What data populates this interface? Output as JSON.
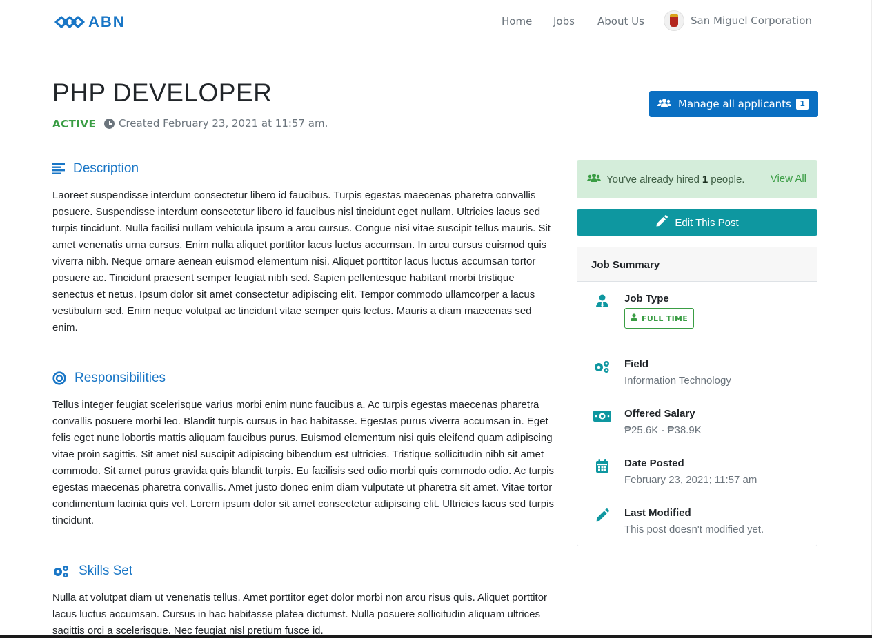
{
  "nav": {
    "brand": "ABN",
    "home": "Home",
    "jobs": "Jobs",
    "about": "About Us",
    "company": "San Miguel Corporation"
  },
  "job": {
    "title": "PHP DEVELOPER",
    "status": "ACTIVE",
    "created": "Created February 23, 2021 at 11:57 am."
  },
  "manage": {
    "label": "Manage all applicants",
    "count": "1"
  },
  "sections": {
    "description": {
      "title": "Description",
      "body": "Laoreet suspendisse interdum consectetur libero id faucibus. Turpis egestas maecenas pharetra convallis posuere. Suspendisse interdum consectetur libero id faucibus nisl tincidunt eget nullam. Ultricies lacus sed turpis tincidunt. Nulla facilisi nullam vehicula ipsum a arcu cursus. Congue nisi vitae suscipit tellus mauris. Sit amet venenatis urna cursus. Enim nulla aliquet porttitor lacus luctus accumsan. In arcu cursus euismod quis viverra nibh. Neque ornare aenean euismod elementum nisi. Aliquet porttitor lacus luctus accumsan tortor posuere ac. Tincidunt praesent semper feugiat nibh sed. Sapien pellentesque habitant morbi tristique senectus et netus. Ipsum dolor sit amet consectetur adipiscing elit. Tempor commodo ullamcorper a lacus vestibulum sed. Enim neque volutpat ac tincidunt vitae semper quis lectus. Mauris a diam maecenas sed enim."
    },
    "responsibilities": {
      "title": "Responsibilities",
      "body": "Tellus integer feugiat scelerisque varius morbi enim nunc faucibus a. Ac turpis egestas maecenas pharetra convallis posuere morbi leo. Blandit turpis cursus in hac habitasse. Egestas purus viverra accumsan in. Eget felis eget nunc lobortis mattis aliquam faucibus purus. Euismod elementum nisi quis eleifend quam adipiscing vitae proin sagittis. Sit amet nisl suscipit adipiscing bibendum est ultricies. Tristique sollicitudin nibh sit amet commodo. Sit amet purus gravida quis blandit turpis. Eu facilisis sed odio morbi quis commodo odio. Ac turpis egestas maecenas pharetra convallis. Amet justo donec enim diam vulputate ut pharetra sit amet. Vitae tortor condimentum lacinia quis vel. Lorem ipsum dolor sit amet consectetur adipiscing elit. Ultricies lacus sed turpis tincidunt."
    },
    "skills": {
      "title": "Skills Set",
      "body": "Nulla at volutpat diam ut venenatis tellus. Amet porttitor eget dolor morbi non arcu risus quis. Aliquet porttitor lacus luctus accumsan. Cursus in hac habitasse platea dictumst. Nulla posuere sollicitudin aliquam ultrices sagittis orci a scelerisque. Nec feugiat nisl pretium fusce id."
    }
  },
  "hired": {
    "prefix": "You've already hired",
    "count": "1",
    "suffix": "people.",
    "view_all": "View All"
  },
  "edit": {
    "label": "Edit This Post"
  },
  "summary": {
    "title": "Job Summary",
    "job_type_label": "Job Type",
    "job_type_value": "FULL TIME",
    "field_label": "Field",
    "field_value": "Information Technology",
    "salary_label": "Offered Salary",
    "salary_value": "₱25.6K - ₱38.9K",
    "date_label": "Date Posted",
    "date_value": "February 23, 2021; 11:57 am",
    "modified_label": "Last Modified",
    "modified_value": "This post doesn't modified yet."
  },
  "colors": {
    "primary": "#0a6fc2",
    "heading_blue": "#1976c6",
    "success": "#3a9d44",
    "teal": "#0e97a0",
    "alert_bg": "#d4edda"
  }
}
